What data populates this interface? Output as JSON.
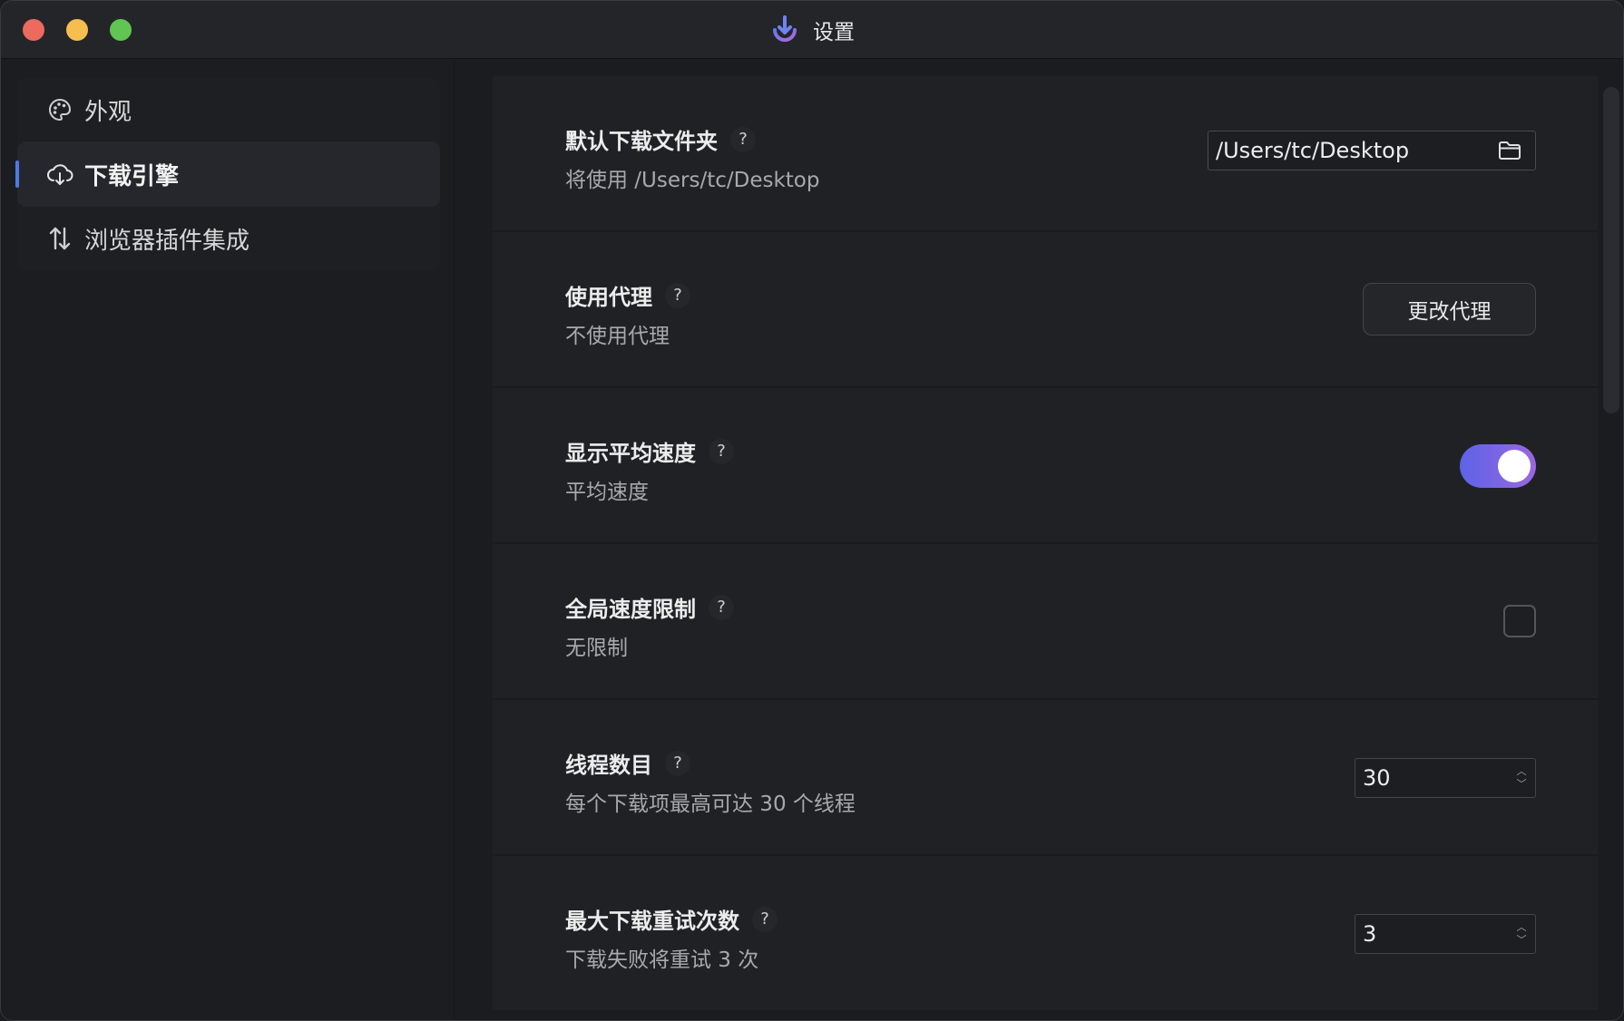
{
  "window": {
    "title": "设置"
  },
  "sidebar": {
    "items": [
      {
        "label": "外观",
        "icon": "palette-icon"
      },
      {
        "label": "下载引擎",
        "icon": "cloud-download-icon",
        "active": true
      },
      {
        "label": "浏览器插件集成",
        "icon": "sort-arrows-icon"
      }
    ]
  },
  "settings": {
    "download_folder": {
      "title": "默认下载文件夹",
      "help": "?",
      "subtitle": "将使用 /Users/tc/Desktop",
      "value": "/Users/tc/Desktop"
    },
    "proxy": {
      "title": "使用代理",
      "help": "?",
      "subtitle": "不使用代理",
      "button_label": "更改代理"
    },
    "avg_speed": {
      "title": "显示平均速度",
      "help": "?",
      "subtitle": "平均速度",
      "enabled": true
    },
    "speed_limit": {
      "title": "全局速度限制",
      "help": "?",
      "subtitle": "无限制",
      "checked": false
    },
    "threads": {
      "title": "线程数目",
      "help": "?",
      "subtitle": "每个下载项最高可达 30 个线程",
      "value": "30"
    },
    "retries": {
      "title": "最大下载重试次数",
      "help": "?",
      "subtitle": "下载失败将重试 3 次",
      "value": "3"
    }
  },
  "colors": {
    "accent": "#4d7ae8",
    "toggle_start": "#5c63e6",
    "toggle_end": "#9b67e0",
    "close": "#ed6a5e",
    "minimize": "#f4bf4f",
    "maximize": "#61c554"
  }
}
